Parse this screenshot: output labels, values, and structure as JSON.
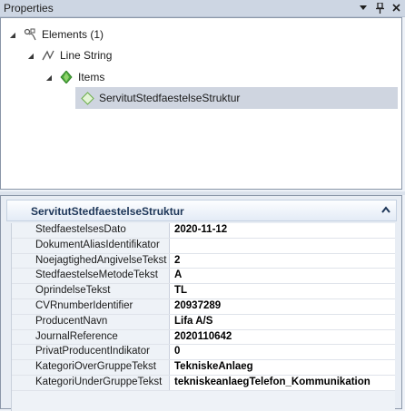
{
  "panel": {
    "title": "Properties",
    "buttons": {
      "dropdown": "▼",
      "pin": "📌",
      "close": "✕"
    }
  },
  "tree": [
    {
      "label": "Elements (1)",
      "icon": "elements-icon"
    },
    {
      "label": "Line String",
      "icon": "line-string-icon"
    },
    {
      "label": "Items",
      "icon": "items-icon"
    },
    {
      "label": "ServitutStedfaestelseStruktur",
      "icon": "item-diamond-icon",
      "selected": true
    }
  ],
  "details": {
    "header": "ServitutStedfaestelseStruktur",
    "collapse_glyph": "⌃",
    "rows": [
      {
        "key": "StedfaestelsesDato",
        "value": "2020-11-12"
      },
      {
        "key": "DokumentAliasIdentifikator",
        "value": ""
      },
      {
        "key": "NoejagtighedAngivelseTekst",
        "value": "2"
      },
      {
        "key": "StedfaestelseMetodeTekst",
        "value": "A"
      },
      {
        "key": "OprindelseTekst",
        "value": "TL"
      },
      {
        "key": "CVRnumberIdentifier",
        "value": "20937289"
      },
      {
        "key": "ProducentNavn",
        "value": "Lifa A/S"
      },
      {
        "key": "JournalReference",
        "value": "2020110642"
      },
      {
        "key": "PrivatProducentIndikator",
        "value": "0"
      },
      {
        "key": "KategoriOverGruppeTekst",
        "value": "TekniskeAnlaeg"
      },
      {
        "key": "KategoriUnderGruppeTekst",
        "value": "tekniskeanlaegTelefon_Kommunikation"
      }
    ]
  },
  "colors": {
    "accent": "#1d3658",
    "selection": "#cfd5e0"
  }
}
